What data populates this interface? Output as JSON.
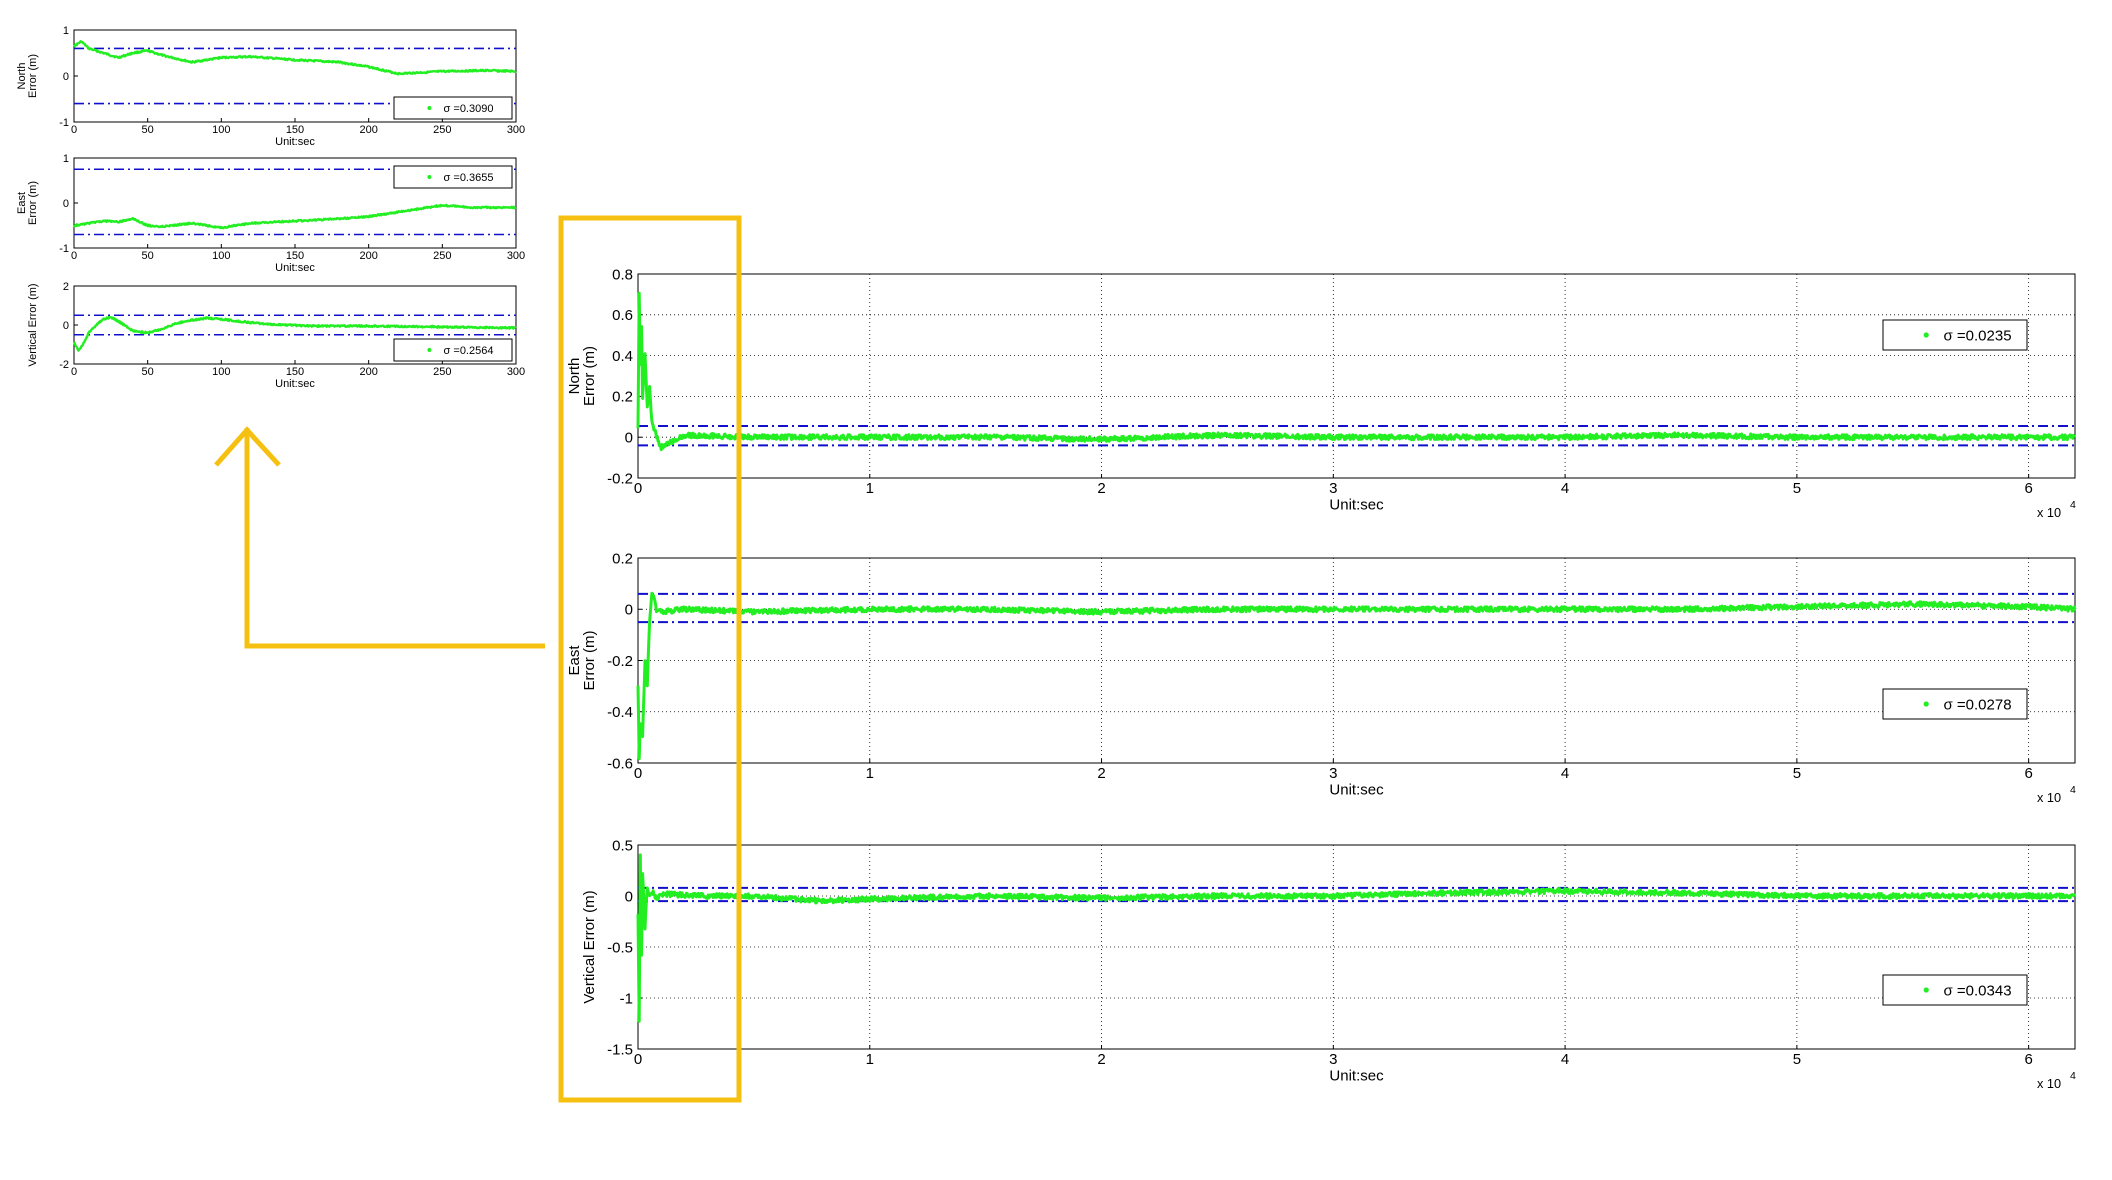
{
  "colors": {
    "series": "#22ee22",
    "bounds": "#1010cc",
    "highlight": "#f5c010",
    "axis": "#000000",
    "grid": "#000000",
    "background": "#ffffff"
  },
  "chart_data": [
    {
      "id": "small-north",
      "type": "line",
      "ylabel_line1": "North",
      "ylabel_line2": "Error (m)",
      "xlabel": "Unit:sec",
      "xlim": [
        0,
        300
      ],
      "ylim": [
        -1,
        1
      ],
      "xticks": [
        "0",
        "50",
        "100",
        "150",
        "200",
        "250",
        "300"
      ],
      "yticks": [
        "-1",
        "0",
        "1"
      ],
      "grid": false,
      "legend": "bottom-right",
      "legend_label": "σ =0.3090",
      "bounds": [
        -0.6,
        0.6
      ],
      "x": [
        0,
        5,
        10,
        20,
        30,
        40,
        50,
        60,
        80,
        100,
        120,
        150,
        180,
        200,
        220,
        250,
        280,
        300
      ],
      "y": [
        0.65,
        0.75,
        0.6,
        0.5,
        0.4,
        0.5,
        0.55,
        0.45,
        0.3,
        0.4,
        0.42,
        0.35,
        0.3,
        0.2,
        0.05,
        0.1,
        0.12,
        0.1
      ]
    },
    {
      "id": "small-east",
      "type": "line",
      "ylabel_line1": "East",
      "ylabel_line2": "Error (m)",
      "xlabel": "Unit:sec",
      "xlim": [
        0,
        300
      ],
      "ylim": [
        -1,
        1
      ],
      "xticks": [
        "0",
        "50",
        "100",
        "150",
        "200",
        "250",
        "300"
      ],
      "yticks": [
        "-1",
        "0",
        "1"
      ],
      "grid": false,
      "legend": "top-right",
      "legend_label": "σ =0.3655",
      "bounds": [
        -0.7,
        0.75
      ],
      "x": [
        0,
        10,
        20,
        30,
        40,
        50,
        60,
        80,
        100,
        120,
        150,
        180,
        200,
        220,
        250,
        270,
        300
      ],
      "y": [
        -0.5,
        -0.45,
        -0.4,
        -0.42,
        -0.35,
        -0.5,
        -0.52,
        -0.45,
        -0.55,
        -0.45,
        -0.4,
        -0.35,
        -0.3,
        -0.2,
        -0.05,
        -0.1,
        -0.1
      ]
    },
    {
      "id": "small-vertical",
      "type": "line",
      "ylabel_line1": "",
      "ylabel_line2": "Vertical Error (m)",
      "xlabel": "Unit:sec",
      "xlim": [
        0,
        300
      ],
      "ylim": [
        -2,
        2
      ],
      "xticks": [
        "0",
        "50",
        "100",
        "150",
        "200",
        "250",
        "300"
      ],
      "yticks": [
        "-2",
        "0",
        "2"
      ],
      "grid": false,
      "legend": "bottom-right",
      "legend_label": "σ =0.2564",
      "bounds": [
        -0.5,
        0.5
      ],
      "x": [
        0,
        3,
        6,
        10,
        15,
        20,
        25,
        30,
        40,
        50,
        60,
        70,
        80,
        90,
        100,
        110,
        130,
        160,
        200,
        250,
        300
      ],
      "y": [
        -0.9,
        -1.3,
        -1.0,
        -0.4,
        0.0,
        0.3,
        0.4,
        0.2,
        -0.3,
        -0.4,
        -0.2,
        0.1,
        0.25,
        0.35,
        0.3,
        0.2,
        0.05,
        -0.05,
        -0.05,
        -0.1,
        -0.15
      ]
    },
    {
      "id": "large-north",
      "type": "line",
      "ylabel_line1": "North",
      "ylabel_line2": "Error (m)",
      "xlabel": "Unit:sec",
      "xlim": [
        0,
        6.2
      ],
      "x_scale_label": "x 10",
      "x_scale_exp": "4",
      "ylim": [
        -0.2,
        0.8
      ],
      "xticks": [
        "0",
        "1",
        "2",
        "3",
        "4",
        "5",
        "6"
      ],
      "yticks": [
        "-0.2",
        "0",
        "0.2",
        "0.4",
        "0.6",
        "0.8"
      ],
      "grid": true,
      "legend": "top-right",
      "legend_label": "σ =0.0235",
      "bounds": [
        -0.04,
        0.055
      ],
      "x": [
        0,
        0.005,
        0.01,
        0.015,
        0.02,
        0.03,
        0.04,
        0.05,
        0.06,
        0.08,
        0.1,
        0.2,
        0.5,
        1,
        1.5,
        2,
        2.5,
        3,
        3.5,
        4,
        4.5,
        5,
        5.5,
        6,
        6.2
      ],
      "y": [
        0.05,
        0.7,
        0.35,
        0.55,
        0.2,
        0.4,
        0.15,
        0.25,
        0.08,
        0.0,
        -0.05,
        0.01,
        0.0,
        0.0,
        0.0,
        -0.01,
        0.01,
        0.0,
        0.0,
        0.0,
        0.01,
        0.0,
        0.0,
        0.0,
        0.0
      ]
    },
    {
      "id": "large-east",
      "type": "line",
      "ylabel_line1": "East",
      "ylabel_line2": "Error (m)",
      "xlabel": "Unit:sec",
      "xlim": [
        0,
        6.2
      ],
      "x_scale_label": "x 10",
      "x_scale_exp": "4",
      "ylim": [
        -0.6,
        0.2
      ],
      "xticks": [
        "0",
        "1",
        "2",
        "3",
        "4",
        "5",
        "6"
      ],
      "yticks": [
        "-0.6",
        "-0.4",
        "-0.2",
        "0",
        "0.2"
      ],
      "grid": true,
      "legend": "bottom-right",
      "legend_label": "σ =0.0278",
      "bounds": [
        -0.05,
        0.06
      ],
      "x": [
        0,
        0.005,
        0.01,
        0.02,
        0.03,
        0.04,
        0.05,
        0.06,
        0.07,
        0.08,
        0.1,
        0.2,
        0.5,
        1,
        1.5,
        2,
        2.5,
        3,
        3.5,
        4,
        4.5,
        5,
        5.5,
        6,
        6.2
      ],
      "y": [
        -0.3,
        -0.58,
        -0.45,
        -0.5,
        -0.2,
        -0.3,
        -0.05,
        0.07,
        0.04,
        0.0,
        -0.01,
        0.0,
        -0.01,
        0.0,
        0.0,
        -0.01,
        0.0,
        0.0,
        0.0,
        0.0,
        0.0,
        0.01,
        0.02,
        0.01,
        0.0
      ]
    },
    {
      "id": "large-vertical",
      "type": "line",
      "ylabel_line1": "",
      "ylabel_line2": "Vertical Error (m)",
      "xlabel": "Unit:sec",
      "xlim": [
        0,
        6.2
      ],
      "x_scale_label": "x 10",
      "x_scale_exp": "4",
      "ylim": [
        -1.5,
        0.5
      ],
      "xticks": [
        "0",
        "1",
        "2",
        "3",
        "4",
        "5",
        "6"
      ],
      "yticks": [
        "-1.5",
        "-1",
        "-0.5",
        "0",
        "0.5"
      ],
      "grid": true,
      "legend": "bottom-right",
      "legend_label": "σ =0.0343",
      "bounds": [
        -0.05,
        0.08
      ],
      "x": [
        0,
        0.005,
        0.01,
        0.015,
        0.02,
        0.03,
        0.04,
        0.05,
        0.06,
        0.08,
        0.1,
        0.3,
        0.5,
        0.8,
        1,
        1.5,
        2,
        2.5,
        3,
        3.5,
        4,
        4.5,
        5,
        5.5,
        6,
        6.2
      ],
      "y": [
        -0.2,
        -1.25,
        0.4,
        -0.6,
        0.2,
        -0.3,
        0.1,
        0.0,
        0.05,
        -0.02,
        0.02,
        0.0,
        0.0,
        -0.05,
        -0.03,
        0.0,
        -0.02,
        0.0,
        0.0,
        0.03,
        0.05,
        0.03,
        0.0,
        0.0,
        0.0,
        0.0
      ]
    }
  ]
}
